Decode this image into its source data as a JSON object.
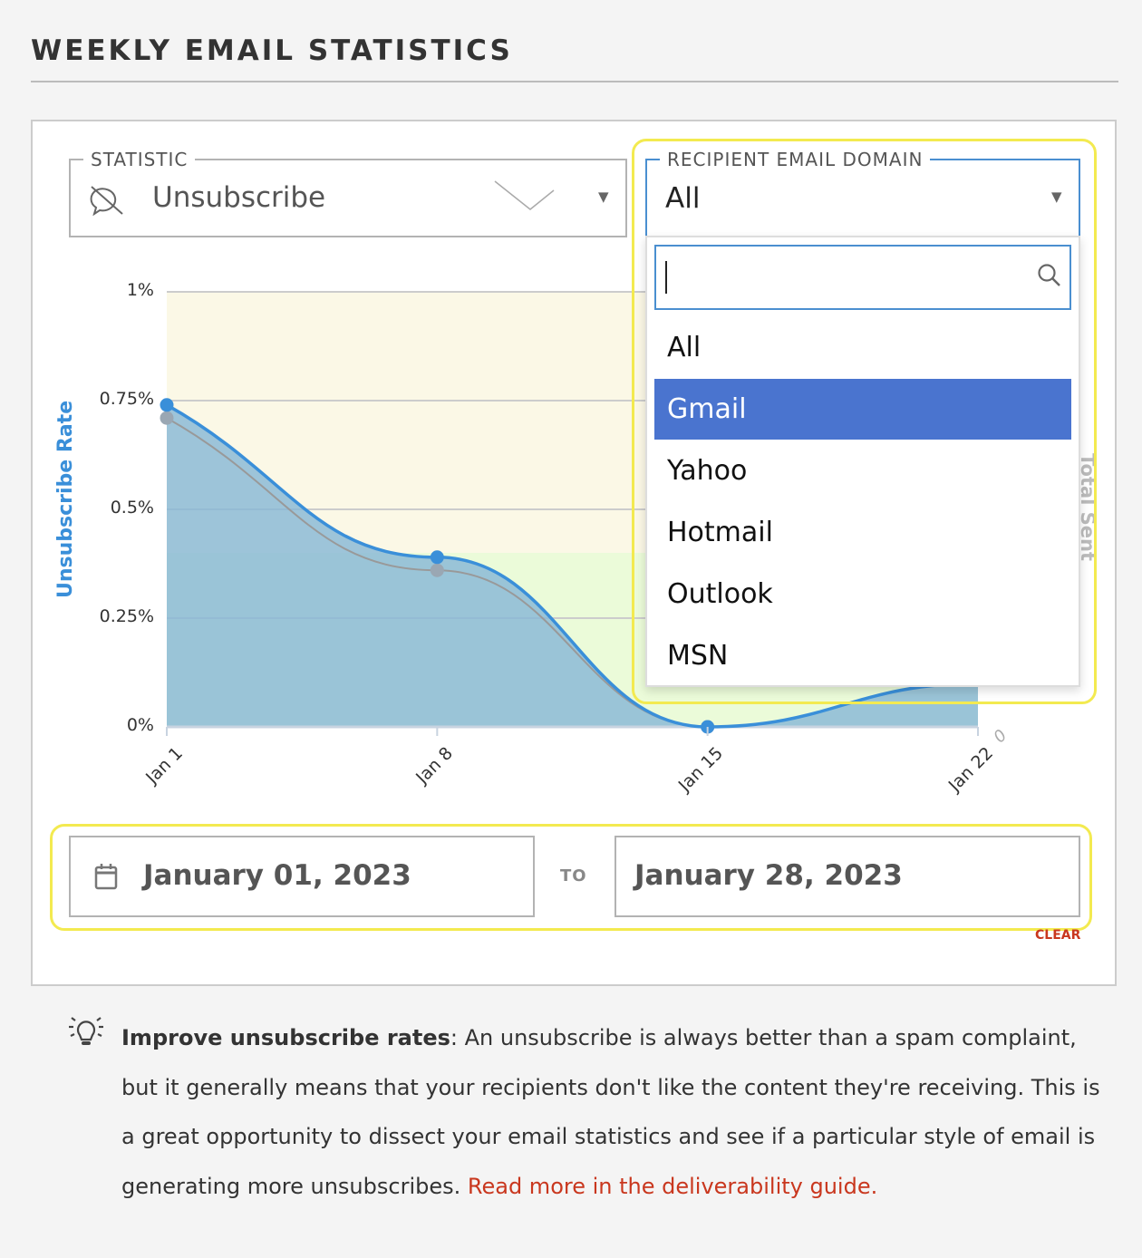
{
  "header": {
    "title": "WEEKLY EMAIL STATISTICS"
  },
  "statistic": {
    "label": "STATISTIC",
    "value": "Unsubscribe",
    "icon": "no-comment-icon"
  },
  "domain_filter": {
    "label": "RECIPIENT EMAIL DOMAIN",
    "value": "All",
    "search_placeholder": "",
    "search_icon": "search-icon",
    "options": [
      {
        "label": "All"
      },
      {
        "label": "Gmail",
        "highlighted": true
      },
      {
        "label": "Yahoo"
      },
      {
        "label": "Hotmail"
      },
      {
        "label": "Outlook"
      },
      {
        "label": "MSN"
      }
    ]
  },
  "chart_data": {
    "type": "area",
    "ylabel": "Unsubscribe Rate",
    "y2label": "Total Sent",
    "y2_ticks": [
      "0"
    ],
    "ylim": [
      0,
      1
    ],
    "y_ticks": [
      "0%",
      "0.25%",
      "0.5%",
      "0.75%",
      "1%"
    ],
    "x": [
      "Jan 1",
      "Jan 8",
      "Jan 15",
      "Jan 22"
    ],
    "series": [
      {
        "values": [
          0.74,
          0.39,
          0,
          0.1
        ],
        "color": "#3a8fd9"
      },
      {
        "values": [
          0.71,
          0.36,
          0,
          0.1
        ],
        "color": "#999999"
      }
    ],
    "bands": [
      {
        "from": 0.4,
        "to": 1,
        "color": "#fbf8e6"
      },
      {
        "from": 0,
        "to": 0.4,
        "color": "#ebfbd9"
      }
    ],
    "grid": true
  },
  "date_range": {
    "start": "January 01, 2023",
    "separator": "TO",
    "end": "January 28, 2023",
    "clear": "CLEAR"
  },
  "tip": {
    "bold": "Improve unsubscribe rates",
    "text": ": An unsubscribe is always better than a spam complaint, but it generally means that your recipients don't like the content they're receiving. This is a great opportunity to dissect your email statistics and see if a particular style of email is generating more unsubscribes. ",
    "link": "Read more in the deliverability guide.",
    "link_color": "#c9371e"
  }
}
